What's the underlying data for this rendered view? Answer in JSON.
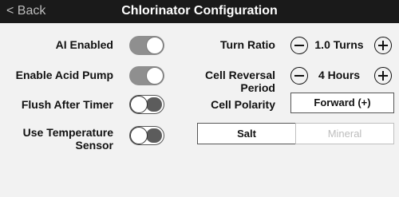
{
  "header": {
    "back_label": "< Back",
    "title": "Chlorinator Configuration"
  },
  "settings": {
    "ai_enabled": {
      "label": "AI Enabled",
      "state": "on"
    },
    "enable_acid_pump": {
      "label": "Enable Acid Pump",
      "state": "on"
    },
    "flush_after_timer": {
      "label": "Flush After Timer",
      "state": "off"
    },
    "use_temperature_sensor": {
      "label_line1": "Use Temperature",
      "label_line2": "Sensor",
      "state": "off"
    }
  },
  "turn_ratio": {
    "label": "Turn Ratio",
    "value": "1.0 Turns"
  },
  "cell_reversal": {
    "label_line1": "Cell Reversal",
    "label_line2": "Period",
    "value": "4 Hours"
  },
  "cell_polarity": {
    "label": "Cell Polarity",
    "value": "Forward (+)"
  },
  "cell_type": {
    "options": [
      "Salt",
      "Mineral"
    ],
    "selected": "Salt"
  }
}
